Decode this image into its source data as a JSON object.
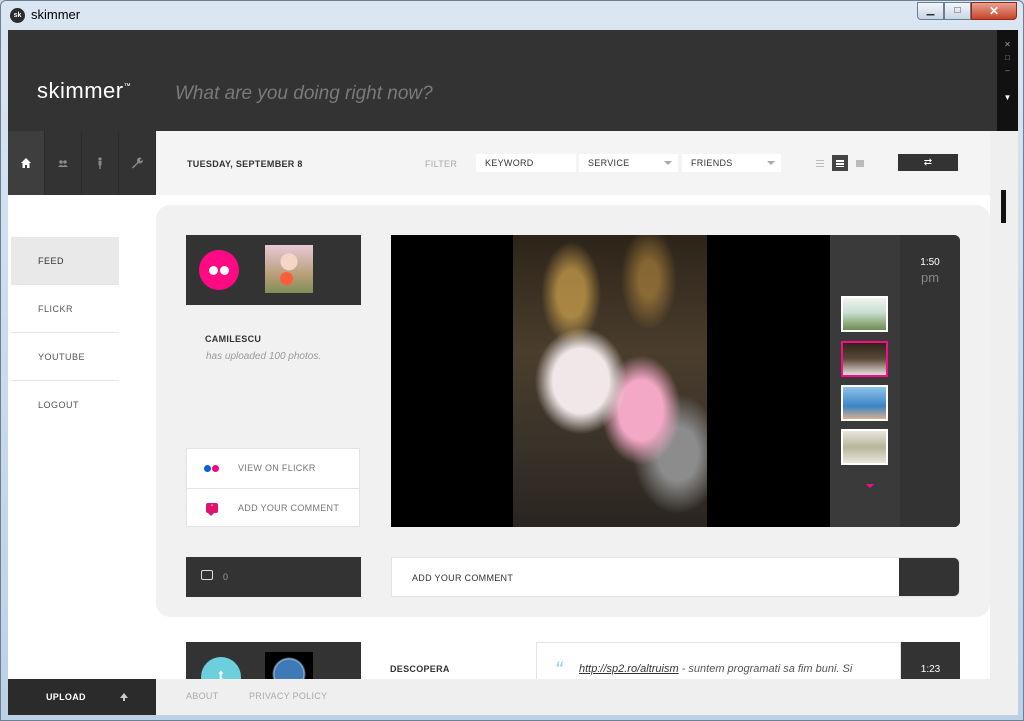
{
  "window": {
    "title": "skimmer",
    "icon_text": "sk"
  },
  "header": {
    "logo": "skimmer",
    "logo_mark": "™",
    "status_placeholder": "What are you doing right now?"
  },
  "nav_icons": [
    "home-icon",
    "friends-icon",
    "person-icon",
    "settings-icon"
  ],
  "filterbar": {
    "date": "TUESDAY, SEPTEMBER 8",
    "filter_label": "FILTER",
    "keyword": "KEYWORD",
    "service": "SERVICE",
    "friends": "FRIENDS"
  },
  "sidemenu": {
    "items": [
      "FEED",
      "FLICKR",
      "YOUTUBE",
      "LOGOUT"
    ],
    "active": "FEED"
  },
  "post1": {
    "username": "CAMILESCU",
    "action": "has uploaded 100 photos.",
    "view_label": "VIEW ON FLICKR",
    "comment_label": "ADD YOUR COMMENT",
    "time": "1:50",
    "ampm": "pm",
    "comment_count": "0",
    "comment_placeholder": "ADD YOUR COMMENT",
    "selected_thumb": 2
  },
  "post2": {
    "username": "DESCOPERA",
    "link": "http://sp2.ro/altruism",
    "text": " - suntem programati sa fim buni. Si",
    "time": "1:23",
    "quote_mark": "“"
  },
  "footer": {
    "upload": "UPLOAD",
    "about": "ABOUT",
    "privacy": "PRIVACY POLICY"
  },
  "colors": {
    "accent": "#ff0a84",
    "dark": "#333333",
    "twitter": "#6ccfde"
  }
}
